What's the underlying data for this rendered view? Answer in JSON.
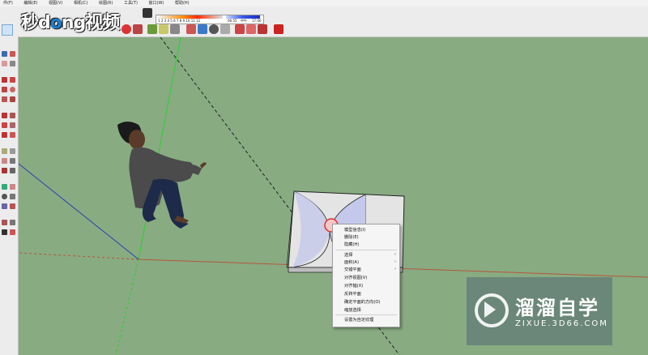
{
  "menu": [
    "件(F)",
    "编辑(E)",
    "视图(V)",
    "相机(C)",
    "绘图(R)",
    "工具(T)",
    "窗口(W)",
    "帮助(H)"
  ],
  "logo": {
    "part1": "秒d",
    "part2": "o",
    "part3": "ng视频"
  },
  "shadow": {
    "month_ticks": "1 2 3 4 5 6 7 8 9 10 11 12",
    "time_start": "06:55",
    "time_mid": "中午",
    "time_end": "17:00"
  },
  "context_menu": {
    "items": [
      {
        "label": "模型信息(I)",
        "submenu": false
      },
      {
        "label": "删除(E)",
        "submenu": false
      },
      {
        "label": "隐藏(H)",
        "submenu": false
      },
      {
        "label": "选择",
        "submenu": true
      },
      {
        "label": "面积(A)",
        "submenu": true
      },
      {
        "label": "交错平面",
        "submenu": true
      },
      {
        "label": "对齐视图(V)",
        "submenu": false
      },
      {
        "label": "对齐轴(X)",
        "submenu": false
      },
      {
        "label": "反转平面",
        "submenu": false
      },
      {
        "label": "确定平面的方向(O)",
        "submenu": false
      },
      {
        "label": "缩放选择",
        "submenu": false
      },
      {
        "label": "设置为自定纹理",
        "submenu": false
      }
    ],
    "arrow_glyph": "›"
  },
  "watermark": {
    "title": "溜溜自学",
    "subtitle": "ZIXUE.3D66.COM"
  },
  "colors": {
    "viewport_bg": "#88ab82",
    "green_axis": "#2bd12b",
    "red_axis": "#b5573a",
    "blue_axis": "#2a3fb0"
  }
}
